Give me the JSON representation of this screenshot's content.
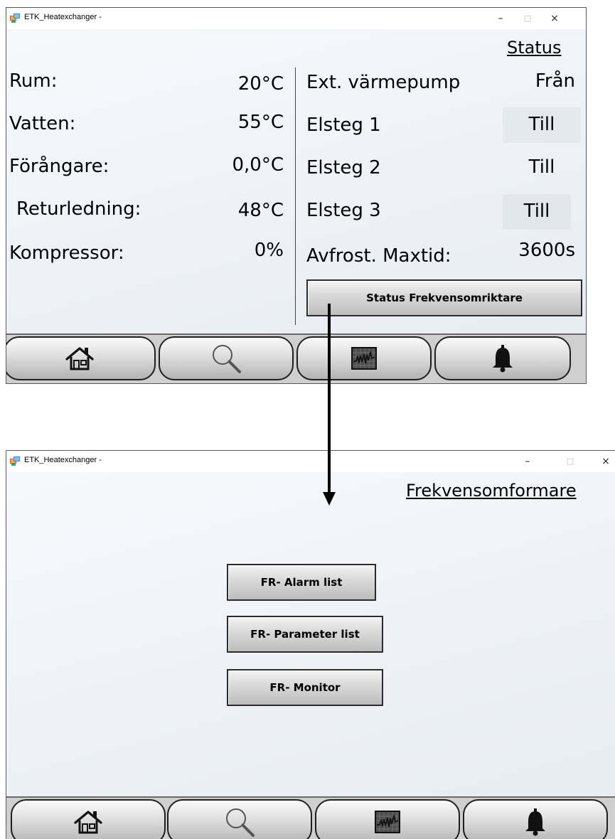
{
  "window_top": {
    "title": "ETK_Heatexchanger -",
    "controls": {
      "minimize": "–",
      "maximize": "□",
      "close": "×"
    },
    "heading": "Status",
    "left_rows": [
      {
        "label": "Rum:",
        "value": "20°C"
      },
      {
        "label": "Vatten:",
        "value": "55°C"
      },
      {
        "label": "Förångare:",
        "value": "0,0°C"
      },
      {
        "label": "Returledning:",
        "value": "48°C"
      },
      {
        "label": "Kompressor:",
        "value": "0%"
      }
    ],
    "right_rows": [
      {
        "label": "Ext. värmepump",
        "value": "Från"
      },
      {
        "label": "Elsteg 1",
        "value": "Till"
      },
      {
        "label": "Elsteg 2",
        "value": "Till"
      },
      {
        "label": "Elsteg 3",
        "value": "Till"
      },
      {
        "label": "Avfrost. Maxtid:",
        "value": "3600s"
      }
    ],
    "status_button": "Status Frekvensomriktare",
    "nav": [
      "home-icon",
      "search-icon",
      "chart-icon",
      "bell-icon"
    ]
  },
  "window_bottom": {
    "title": "ETK_Heatexchanger -",
    "controls": {
      "minimize": "–",
      "maximize": "□",
      "close": "×"
    },
    "heading": "Frekvensomformare",
    "buttons": [
      "FR- Alarm list",
      "FR- Parameter list",
      "FR- Monitor"
    ],
    "nav": [
      "home-icon",
      "search-icon",
      "chart-icon",
      "bell-icon"
    ]
  },
  "colors": {
    "background": "#eef2f7",
    "button_gradient_top": "#f4f4f4",
    "button_gradient_bottom": "#bdbdbd",
    "border": "#2b2b2b"
  }
}
